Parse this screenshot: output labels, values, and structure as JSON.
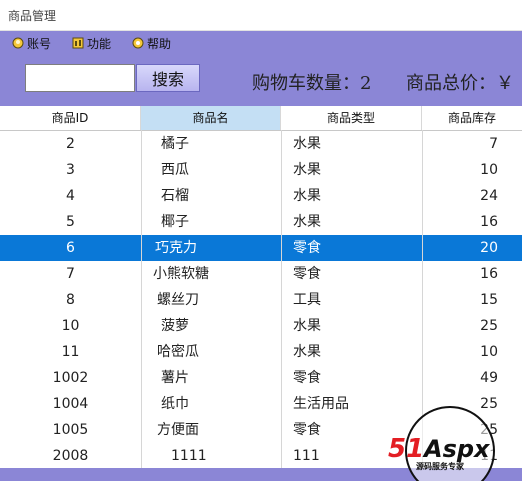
{
  "window": {
    "title": "商品管理"
  },
  "menu": {
    "items": [
      {
        "label": "账号",
        "icon": "account-icon"
      },
      {
        "label": "功能",
        "icon": "function-icon"
      },
      {
        "label": "帮助",
        "icon": "help-icon"
      }
    ]
  },
  "toolbar": {
    "search_value": "",
    "search_button": "搜索",
    "cart_label": "购物车数量：2",
    "total_label": "商品总价：￥"
  },
  "table": {
    "columns": [
      "商品ID",
      "商品名",
      "商品类型",
      "商品库存"
    ],
    "rows": [
      [
        "2",
        "橘子",
        "水果",
        "7"
      ],
      [
        "3",
        "西瓜",
        "水果",
        "10"
      ],
      [
        "4",
        "石榴",
        "水果",
        "24"
      ],
      [
        "5",
        "椰子",
        "水果",
        "16"
      ],
      [
        "6",
        "巧克力",
        "零食",
        "20"
      ],
      [
        "7",
        "小熊软糖",
        "零食",
        "16"
      ],
      [
        "8",
        "螺丝刀",
        "工具",
        "15"
      ],
      [
        "10",
        "菠萝",
        "水果",
        "25"
      ],
      [
        "11",
        "哈密瓜",
        "水果",
        "10"
      ],
      [
        "1002",
        "薯片",
        "零食",
        "49"
      ],
      [
        "1004",
        "纸巾",
        "生活用品",
        "25"
      ],
      [
        "1005",
        "方便面",
        "零食",
        "25"
      ],
      [
        "2008",
        "1111",
        "111",
        "11"
      ]
    ],
    "selected_row": 4,
    "active_column": 1
  },
  "watermark": {
    "brand": "51Aspx",
    "tagline": "源码服务专家"
  },
  "colors": {
    "chrome": "#8b86d6",
    "selection": "#0a78d7",
    "header_active": "#c4dff4",
    "brand_red": "#e31e24"
  }
}
